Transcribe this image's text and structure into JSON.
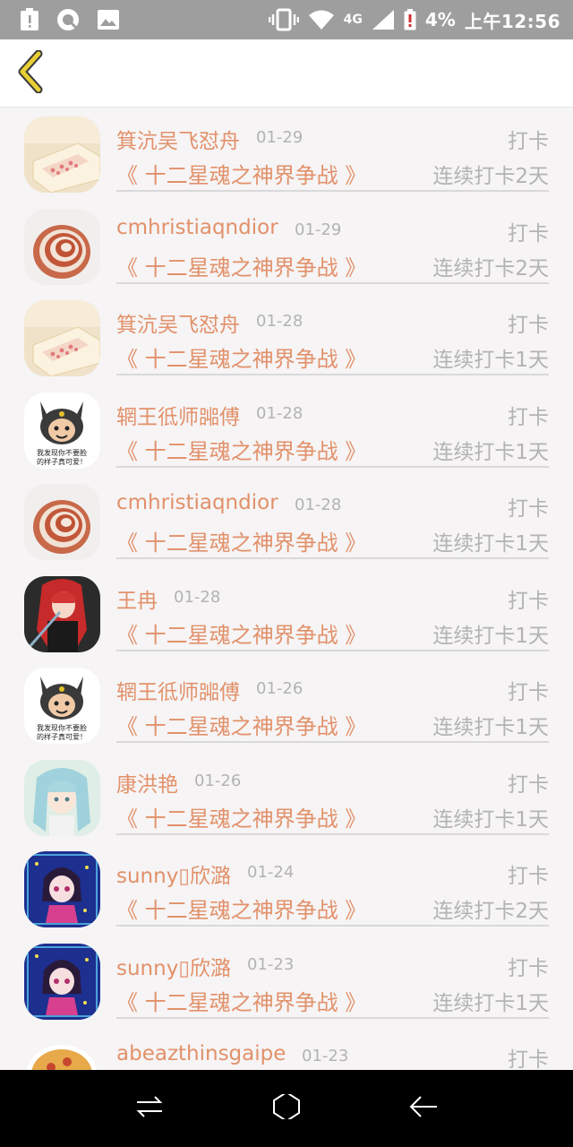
{
  "status_bar": {
    "network": "4G",
    "battery": "4%",
    "time": "上午12:56",
    "icons": [
      "alert-icon",
      "browser-icon",
      "image-icon",
      "vibrate-icon",
      "wifi-icon",
      "signal-icon",
      "battery-icon"
    ]
  },
  "header": {
    "back_icon": "chevron-left-icon"
  },
  "checkins": [
    {
      "name": "箕沆吴飞怼舟",
      "date": "01-29",
      "type": "打卡",
      "book": "《 十二星魂之神界争战 》",
      "streak": "连续打卡2天",
      "avatar": "dessert"
    },
    {
      "name": "cmhristiaqndior",
      "date": "01-29",
      "type": "打卡",
      "book": "《 十二星魂之神界争战 》",
      "streak": "连续打卡2天",
      "avatar": "shell"
    },
    {
      "name": "箕沆吴飞怼舟",
      "date": "01-28",
      "type": "打卡",
      "book": "《 十二星魂之神界争战 》",
      "streak": "连续打卡1天",
      "avatar": "dessert"
    },
    {
      "name": "辋王彽师嘂傅",
      "date": "01-28",
      "type": "打卡",
      "book": "《 十二星魂之神界争战 》",
      "streak": "连续打卡1天",
      "avatar": "cat"
    },
    {
      "name": "cmhristiaqndior",
      "date": "01-28",
      "type": "打卡",
      "book": "《 十二星魂之神界争战 》",
      "streak": "连续打卡1天",
      "avatar": "shell"
    },
    {
      "name": "王冉",
      "date": "01-28",
      "type": "打卡",
      "book": "《 十二星魂之神界争战 》",
      "streak": "连续打卡1天",
      "avatar": "anime-red"
    },
    {
      "name": "辋王彽师嘂傅",
      "date": "01-26",
      "type": "打卡",
      "book": "《 十二星魂之神界争战 》",
      "streak": "连续打卡1天",
      "avatar": "cat"
    },
    {
      "name": "康洪艳",
      "date": "01-26",
      "type": "打卡",
      "book": "《 十二星魂之神界争战 》",
      "streak": "连续打卡1天",
      "avatar": "anime-teal"
    },
    {
      "name": "sunny▯欣潞",
      "date": "01-24",
      "type": "打卡",
      "book": "《 十二星魂之神界争战 》",
      "streak": "连续打卡2天",
      "avatar": "anime-blue"
    },
    {
      "name": "sunny▯欣潞",
      "date": "01-23",
      "type": "打卡",
      "book": "《 十二星魂之神界争战 》",
      "streak": "连续打卡1天",
      "avatar": "anime-blue"
    },
    {
      "name": "abeazthinsgaipe",
      "date": "01-23",
      "type": "打卡",
      "book": "",
      "streak": "",
      "avatar": "food"
    }
  ],
  "cat_avatar_caption": [
    "我发现你不要脸",
    "的样子真可爱！"
  ],
  "nav": {
    "icons": [
      "recent-apps-icon",
      "home-icon",
      "back-arrow-icon"
    ]
  },
  "colors": {
    "accent": "#e2916a",
    "muted": "#b3b3b3",
    "status_bar": "#9e9e9e",
    "back_icon": "#e7cf34"
  }
}
